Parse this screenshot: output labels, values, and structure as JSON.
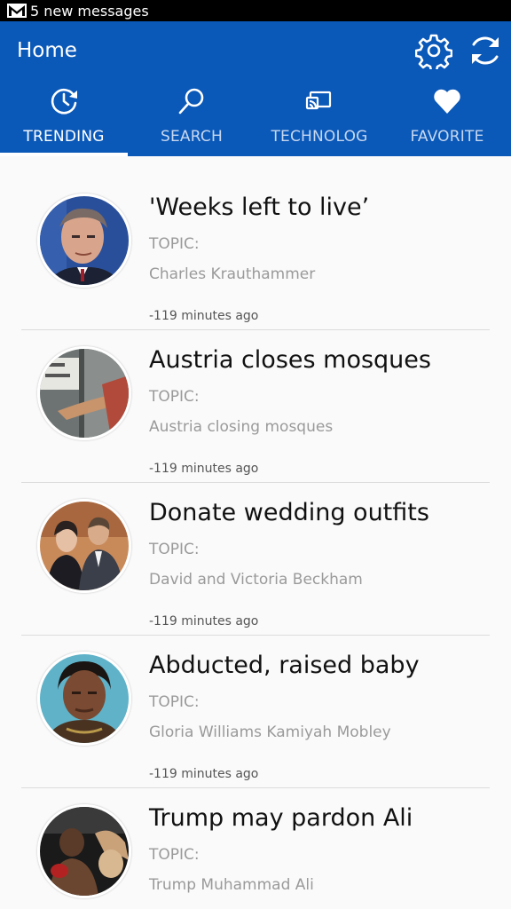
{
  "status": {
    "notification_text": "5 new messages",
    "icon": "gmail-icon"
  },
  "appbar": {
    "title": "Home",
    "settings_icon": "gear-icon",
    "refresh_icon": "refresh-icon",
    "color": "#0a58b8"
  },
  "tabs": [
    {
      "label": "TRENDING",
      "icon": "clock-refresh-icon",
      "active": true
    },
    {
      "label": "SEARCH",
      "icon": "search-icon",
      "active": false
    },
    {
      "label": "TECHNOLOG",
      "icon": "cast-icon",
      "active": false
    },
    {
      "label": "FAVORITE",
      "icon": "heart-icon",
      "active": false
    }
  ],
  "articles": [
    {
      "headline": "'Weeks left to live’",
      "topic_label": "TOPIC:",
      "topic": "Charles Krauthammer",
      "time": "-119 minutes ago"
    },
    {
      "headline": "Austria closes mosques",
      "topic_label": "TOPIC:",
      "topic": "Austria closing mosques",
      "time": "-119 minutes ago"
    },
    {
      "headline": "Donate wedding outfits",
      "topic_label": "TOPIC:",
      "topic": "David and Victoria Beckham",
      "time": "-119 minutes ago"
    },
    {
      "headline": "Abducted, raised baby",
      "topic_label": "TOPIC:",
      "topic": "Gloria Williams Kamiyah Mobley",
      "time": "-119 minutes ago"
    },
    {
      "headline": "Trump may pardon Ali",
      "topic_label": "TOPIC:",
      "topic": "Trump Muhammad Ali",
      "time": ""
    }
  ]
}
